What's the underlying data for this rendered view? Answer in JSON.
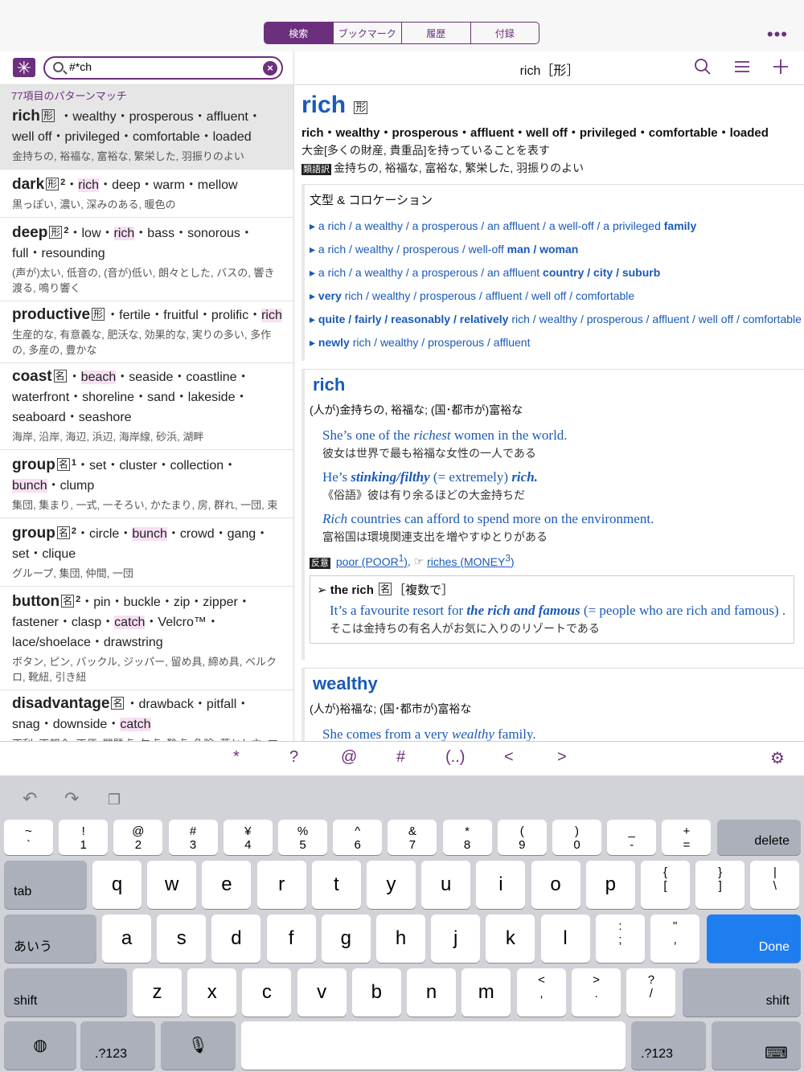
{
  "tabs": [
    "検索",
    "ブックマーク",
    "履歴",
    "付録"
  ],
  "search": {
    "value": "#*ch",
    "match_count": "77項目のパターンマッチ"
  },
  "entries": [
    {
      "hw": "rich",
      "pos": "形",
      "sup": "",
      "syn1": " ・wealthy・prosperous・affluent・well off・privileged・comfortable・loaded",
      "hl": "",
      "syn2": "",
      "ja": "金持ちの, 裕福な, 富裕な, 繁栄した, 羽振りのよい"
    },
    {
      "hw": "dark",
      "pos": "形",
      "sup": "2",
      "syn1": "・",
      "hl": "rich",
      "syn2": "・deep・warm・mellow",
      "ja": "黒っぽい, 濃い, 深みのある, 暖色の"
    },
    {
      "hw": "deep",
      "pos": "形",
      "sup": "2",
      "syn1": "・low・",
      "hl": "rich",
      "syn2": "・bass・sonorous・full・resounding",
      "ja": "(声が)太い, 低音の, (音が)低い, 朗々とした, バスの, 響き渡る, 鳴り響く"
    },
    {
      "hw": "productive",
      "pos": "形",
      "sup": "",
      "syn1": "・fertile・fruitful・prolific・",
      "hl": "rich",
      "syn2": "",
      "ja": "生産的な, 有意義な, 肥沃な, 効果的な, 実りの多い, 多作の, 多産の, 豊かな"
    },
    {
      "hw": "coast",
      "pos": "名",
      "sup": "",
      "syn1": "・",
      "hl": "beach",
      "syn2": "・seaside・coastline・waterfront・shoreline・sand・lakeside・seaboard・seashore",
      "ja": "海岸, 沿岸, 海辺, 浜辺, 海岸線, 砂浜, 湖畔"
    },
    {
      "hw": "group",
      "pos": "名",
      "sup": "1",
      "syn1": "・set・cluster・collection・",
      "hl": "bunch",
      "syn2": "・clump",
      "ja": "集団, 集まり, 一式, 一そろい, かたまり, 房, 群れ, 一団, 束"
    },
    {
      "hw": "group",
      "pos": "名",
      "sup": "2",
      "syn1": "・circle・",
      "hl": "bunch",
      "syn2": "・crowd・gang・set・clique",
      "ja": "グループ, 集団, 仲間, 一団"
    },
    {
      "hw": "button",
      "pos": "名",
      "sup": "2",
      "syn1": "・pin・buckle・zip・zipper・fastener・clasp・",
      "hl": "catch",
      "syn2": "・Velcro™・lace/shoelace・drawstring",
      "ja": "ボタン, ピン, バックル, ジッパー, 留め具, 締め具, ベルクロ, 靴紐, 引き紐"
    },
    {
      "hw": "disadvantage",
      "pos": "名",
      "sup": "",
      "syn1": "・drawback・pitfall・snag・downside・",
      "hl": "catch",
      "syn2": "",
      "ja": "不利, 不都合, 不便, 問題点, 欠点, 難点, 危険, 落とし穴, マイナス面, 罠"
    }
  ],
  "right": {
    "title": "rich［形］",
    "headword": "rich",
    "pos": "形",
    "synonyms": "rich・wealthy・prosperous・affluent・well off・privileged・comfortable・loaded",
    "meaning": "大金[多くの財産, 貴重品]を持っていることを表す",
    "similar_tag": "類語訳",
    "similar": "金持ちの, 裕福な, 富裕な, 繁栄した, 羽振りのよい",
    "colloc_title": "文型 & コロケーション",
    "collocations": [
      {
        "plain": "a rich / a wealthy / a prosperous / an affluent / a well-off / a privileged ",
        "bold": "family",
        "after": ""
      },
      {
        "plain": "a rich / wealthy / prosperous / well-off ",
        "bold": "man / woman",
        "after": ""
      },
      {
        "plain": "a rich / a wealthy / a prosperous / an affluent ",
        "bold": "country / city / suburb",
        "after": ""
      },
      {
        "plain": "",
        "bold": "very",
        "after": " rich / wealthy / prosperous / affluent / well off / comfortable"
      },
      {
        "plain": "",
        "bold": "quite / fairly / reasonably / relatively",
        "after": " rich / wealthy / prosperous / affluent / well off / comfortable"
      },
      {
        "plain": "",
        "bold": "newly",
        "after": " rich / wealthy / prosperous / affluent"
      }
    ],
    "sec1_hw": "rich",
    "sec1_def": "(人が)金持ちの, 裕福な; (国･都市が)富裕な",
    "ex1_a": "She’s one of the ",
    "ex1_i": "richest",
    "ex1_b": " women in the world.",
    "ex1_ja": "彼女は世界で最も裕福な女性の一人である",
    "ex2_a": "He’s ",
    "ex2_i": "stinking/filthy",
    "ex2_b": " (= extremely) ",
    "ex2_c": "rich.",
    "ex2_ja": "《俗語》彼は有り余るほどの大金持ちだ",
    "ex3_i": "Rich",
    "ex3_b": " countries can afford to spend more on the environment.",
    "ex3_ja": "富裕国は環境関連支出を増やすゆとりがある",
    "ant_tag": "反意",
    "ant1": "poor (POOR",
    "ant1_sup": "1",
    "ant2": "riches (MONEY",
    "ant2_sup": "3",
    "phrase_hw": "the rich",
    "phrase_pos": "名",
    "phrase_note": "［複数で］",
    "phrase_ex_a": "It’s a favourite resort for ",
    "phrase_ex_i": "the rich and famous",
    "phrase_ex_b": " (= people who are rich and famous) .",
    "phrase_ja": "そこは金持ちの有名人がお気に入りのリゾートである",
    "sec2_hw": "wealthy",
    "sec2_def": "(人が)裕福な; (国･都市が)富裕な",
    "ex4_a": "She comes from a very ",
    "ex4_i": "wealthy",
    "ex4_b": " family."
  },
  "symbols": [
    "*",
    "?",
    "@",
    "#",
    "(..)",
    "<",
    ">"
  ],
  "keyboard": {
    "num_row": [
      [
        "~",
        "`"
      ],
      [
        "!",
        "1"
      ],
      [
        "@",
        "2"
      ],
      [
        "#",
        "3"
      ],
      [
        "¥",
        "4"
      ],
      [
        "%",
        "5"
      ],
      [
        "^",
        "6"
      ],
      [
        "&",
        "7"
      ],
      [
        "*",
        "8"
      ],
      [
        "(",
        "9"
      ],
      [
        ")",
        "0"
      ],
      [
        "_",
        "-"
      ],
      [
        "+",
        "="
      ]
    ],
    "row_q": [
      "q",
      "w",
      "e",
      "r",
      "t",
      "y",
      "u",
      "i",
      "o",
      "p"
    ],
    "row_q_extra": [
      [
        "{",
        "["
      ],
      [
        "}",
        "]"
      ],
      [
        "|",
        "\\"
      ]
    ],
    "row_a": [
      "a",
      "s",
      "d",
      "f",
      "g",
      "h",
      "j",
      "k",
      "l"
    ],
    "row_a_extra": [
      [
        ":",
        ";"
      ],
      [
        "\"",
        ","
      ]
    ],
    "row_z": [
      "z",
      "x",
      "c",
      "v",
      "b",
      "n",
      "m"
    ],
    "row_z_extra": [
      [
        "<",
        ","
      ],
      [
        ">",
        "."
      ],
      [
        "?",
        "/"
      ]
    ],
    "delete": "delete",
    "tab": "tab",
    "kana": "あいう",
    "done": "Done",
    "shift": "shift",
    "num": ".?123"
  }
}
